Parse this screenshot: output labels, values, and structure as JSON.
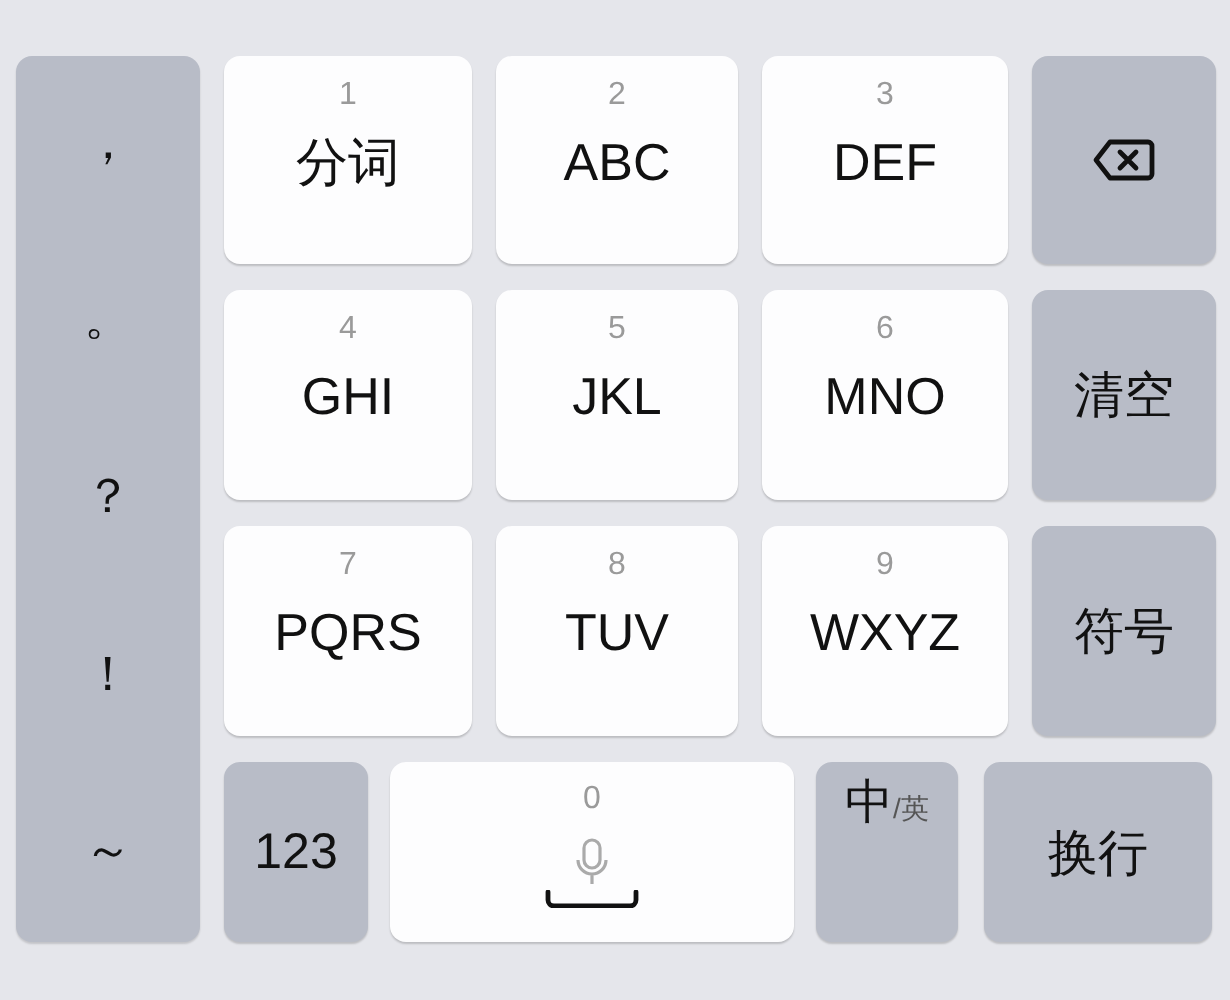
{
  "punctuation": [
    "，",
    "。",
    "？",
    "！",
    "～"
  ],
  "digit_keys": [
    {
      "digit": "1",
      "label": "分词"
    },
    {
      "digit": "2",
      "label": "ABC"
    },
    {
      "digit": "3",
      "label": "DEF"
    },
    {
      "digit": "4",
      "label": "GHI"
    },
    {
      "digit": "5",
      "label": "JKL"
    },
    {
      "digit": "6",
      "label": "MNO"
    },
    {
      "digit": "7",
      "label": "PQRS"
    },
    {
      "digit": "8",
      "label": "TUV"
    },
    {
      "digit": "9",
      "label": "WXYZ"
    }
  ],
  "function_keys": [
    {
      "kind": "backspace"
    },
    {
      "kind": "text",
      "label": "清空"
    },
    {
      "kind": "text",
      "label": "符号"
    }
  ],
  "bottom_row": [
    {
      "kind": "text",
      "label": "123"
    },
    {
      "kind": "space",
      "digit": "0"
    },
    {
      "kind": "language",
      "primary": "中",
      "secondary": "/英"
    },
    {
      "kind": "text",
      "label": "换行"
    }
  ]
}
